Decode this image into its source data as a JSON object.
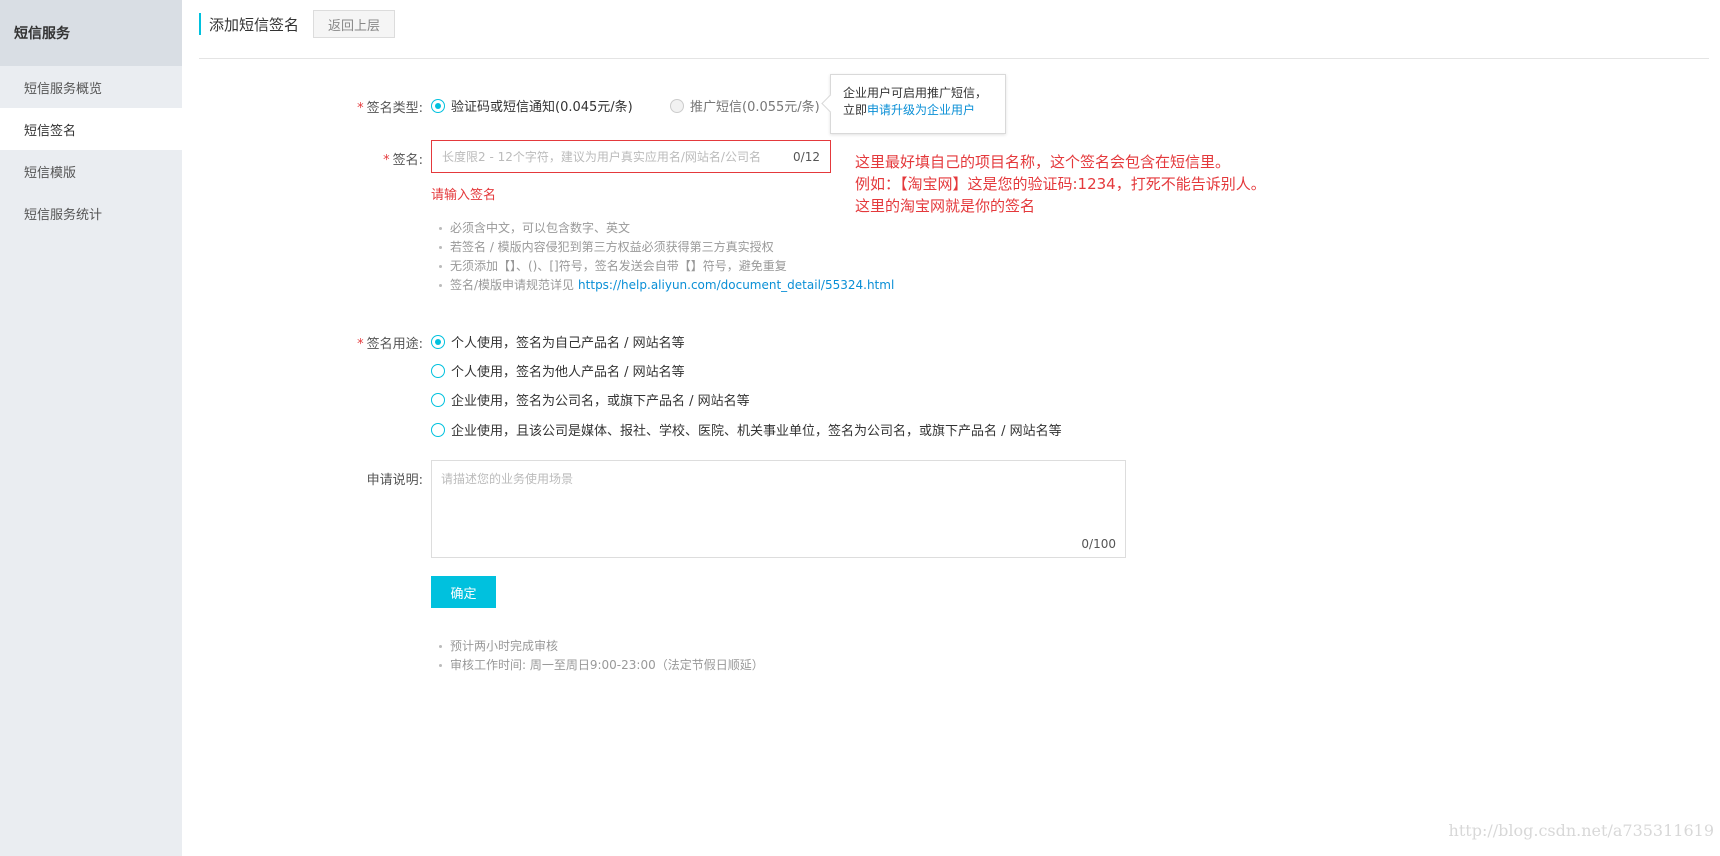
{
  "sidebar": {
    "header": "短信服务",
    "items": [
      {
        "label": "短信服务概览"
      },
      {
        "label": "短信签名"
      },
      {
        "label": "短信模版"
      },
      {
        "label": "短信服务统计"
      }
    ]
  },
  "header": {
    "title": "添加短信签名",
    "back_label": "返回上层"
  },
  "form": {
    "sig_type": {
      "label": "签名类型:",
      "option1": "验证码或短信通知(0.045元/条)",
      "option2": "推广短信(0.055元/条)"
    },
    "tooltip": {
      "line1": "企业用户可启用推广短信，",
      "prefix": "立即",
      "link": "申请升级为企业用户"
    },
    "signature": {
      "label": "签名:",
      "placeholder": "长度限2 - 12个字符，建议为用户真实应用名/网站名/公司名",
      "count": "0/12",
      "error": "请输入签名"
    },
    "tips": [
      "必须含中文，可以包含数字、英文",
      "若签名 / 模版内容侵犯到第三方权益必须获得第三方真实授权",
      "无须添加【】、()、[]符号，签名发送会自带【】符号，避免重复",
      "签名/模版申请规范详见"
    ],
    "tips_link": "https://help.aliyun.com/document_detail/55324.html",
    "usage": {
      "label": "签名用途:",
      "options": [
        "个人使用，签名为自己产品名 / 网站名等",
        "个人使用，签名为他人产品名 / 网站名等",
        "企业使用，签名为公司名，或旗下产品名 / 网站名等",
        "企业使用，且该公司是媒体、报社、学校、医院、机关事业单位，签名为公司名，或旗下产品名 / 网站名等"
      ]
    },
    "description": {
      "label": "申请说明:",
      "placeholder": "请描述您的业务使用场景",
      "count": "0/100"
    },
    "confirm_label": "确定",
    "footer_tips": [
      "预计两小时完成审核",
      "审核工作时间: 周一至周日9:00-23:00（法定节假日顺延）"
    ]
  },
  "annotation": {
    "line1": "这里最好填自己的项目名称，这个签名会包含在短信里。",
    "line2": "例如：【淘宝网】这是您的验证码:1234，打死不能告诉别人。",
    "line3": "这里的淘宝网就是你的签名"
  },
  "watermark": "http://blog.csdn.net/a735311619",
  "colors": {
    "accent": "#00c1de",
    "error": "#e4393c",
    "link": "#0a8fd6"
  }
}
